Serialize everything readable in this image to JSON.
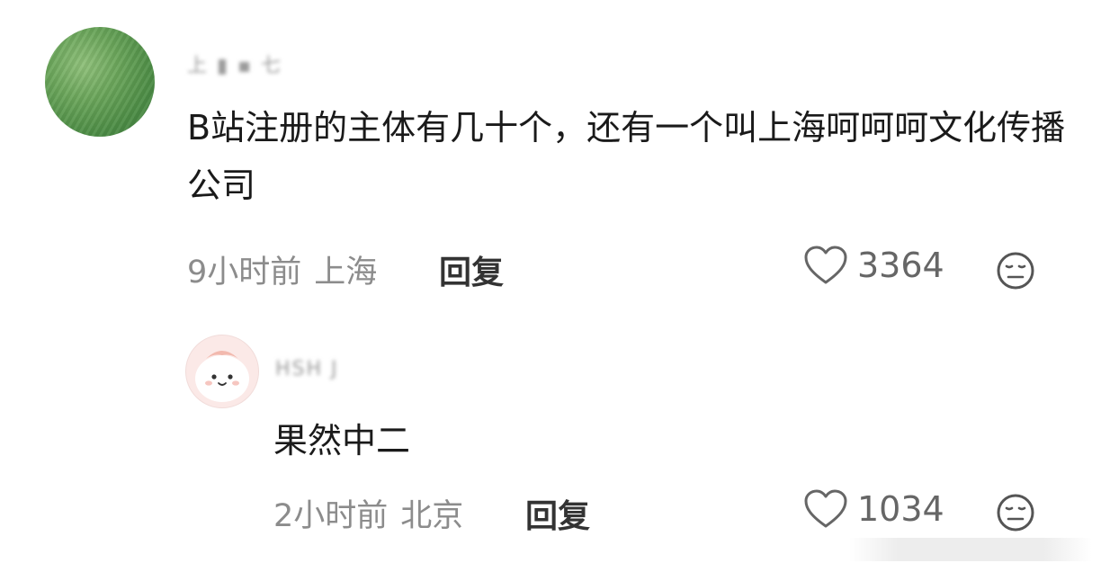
{
  "main_comment": {
    "username": "上 ▮ ▪ 七",
    "text": "B站注册的主体有几十个，还有一个叫上海呵呵呵文化传播公司",
    "time": "9小时前",
    "location": "上海",
    "reply_label": "回复",
    "likes": "3364",
    "icons": {
      "like": "heart-outline-icon",
      "emoji": "neutral-face-icon"
    }
  },
  "reply_comment": {
    "username": "HSH J",
    "text": "果然中二",
    "time": "2小时前",
    "location": "北京",
    "reply_label": "回复",
    "likes": "1034",
    "icons": {
      "like": "heart-outline-icon",
      "emoji": "neutral-face-icon"
    }
  },
  "colors": {
    "text": "#1a1a1a",
    "meta": "#8c8c8c",
    "icon": "#666666"
  }
}
